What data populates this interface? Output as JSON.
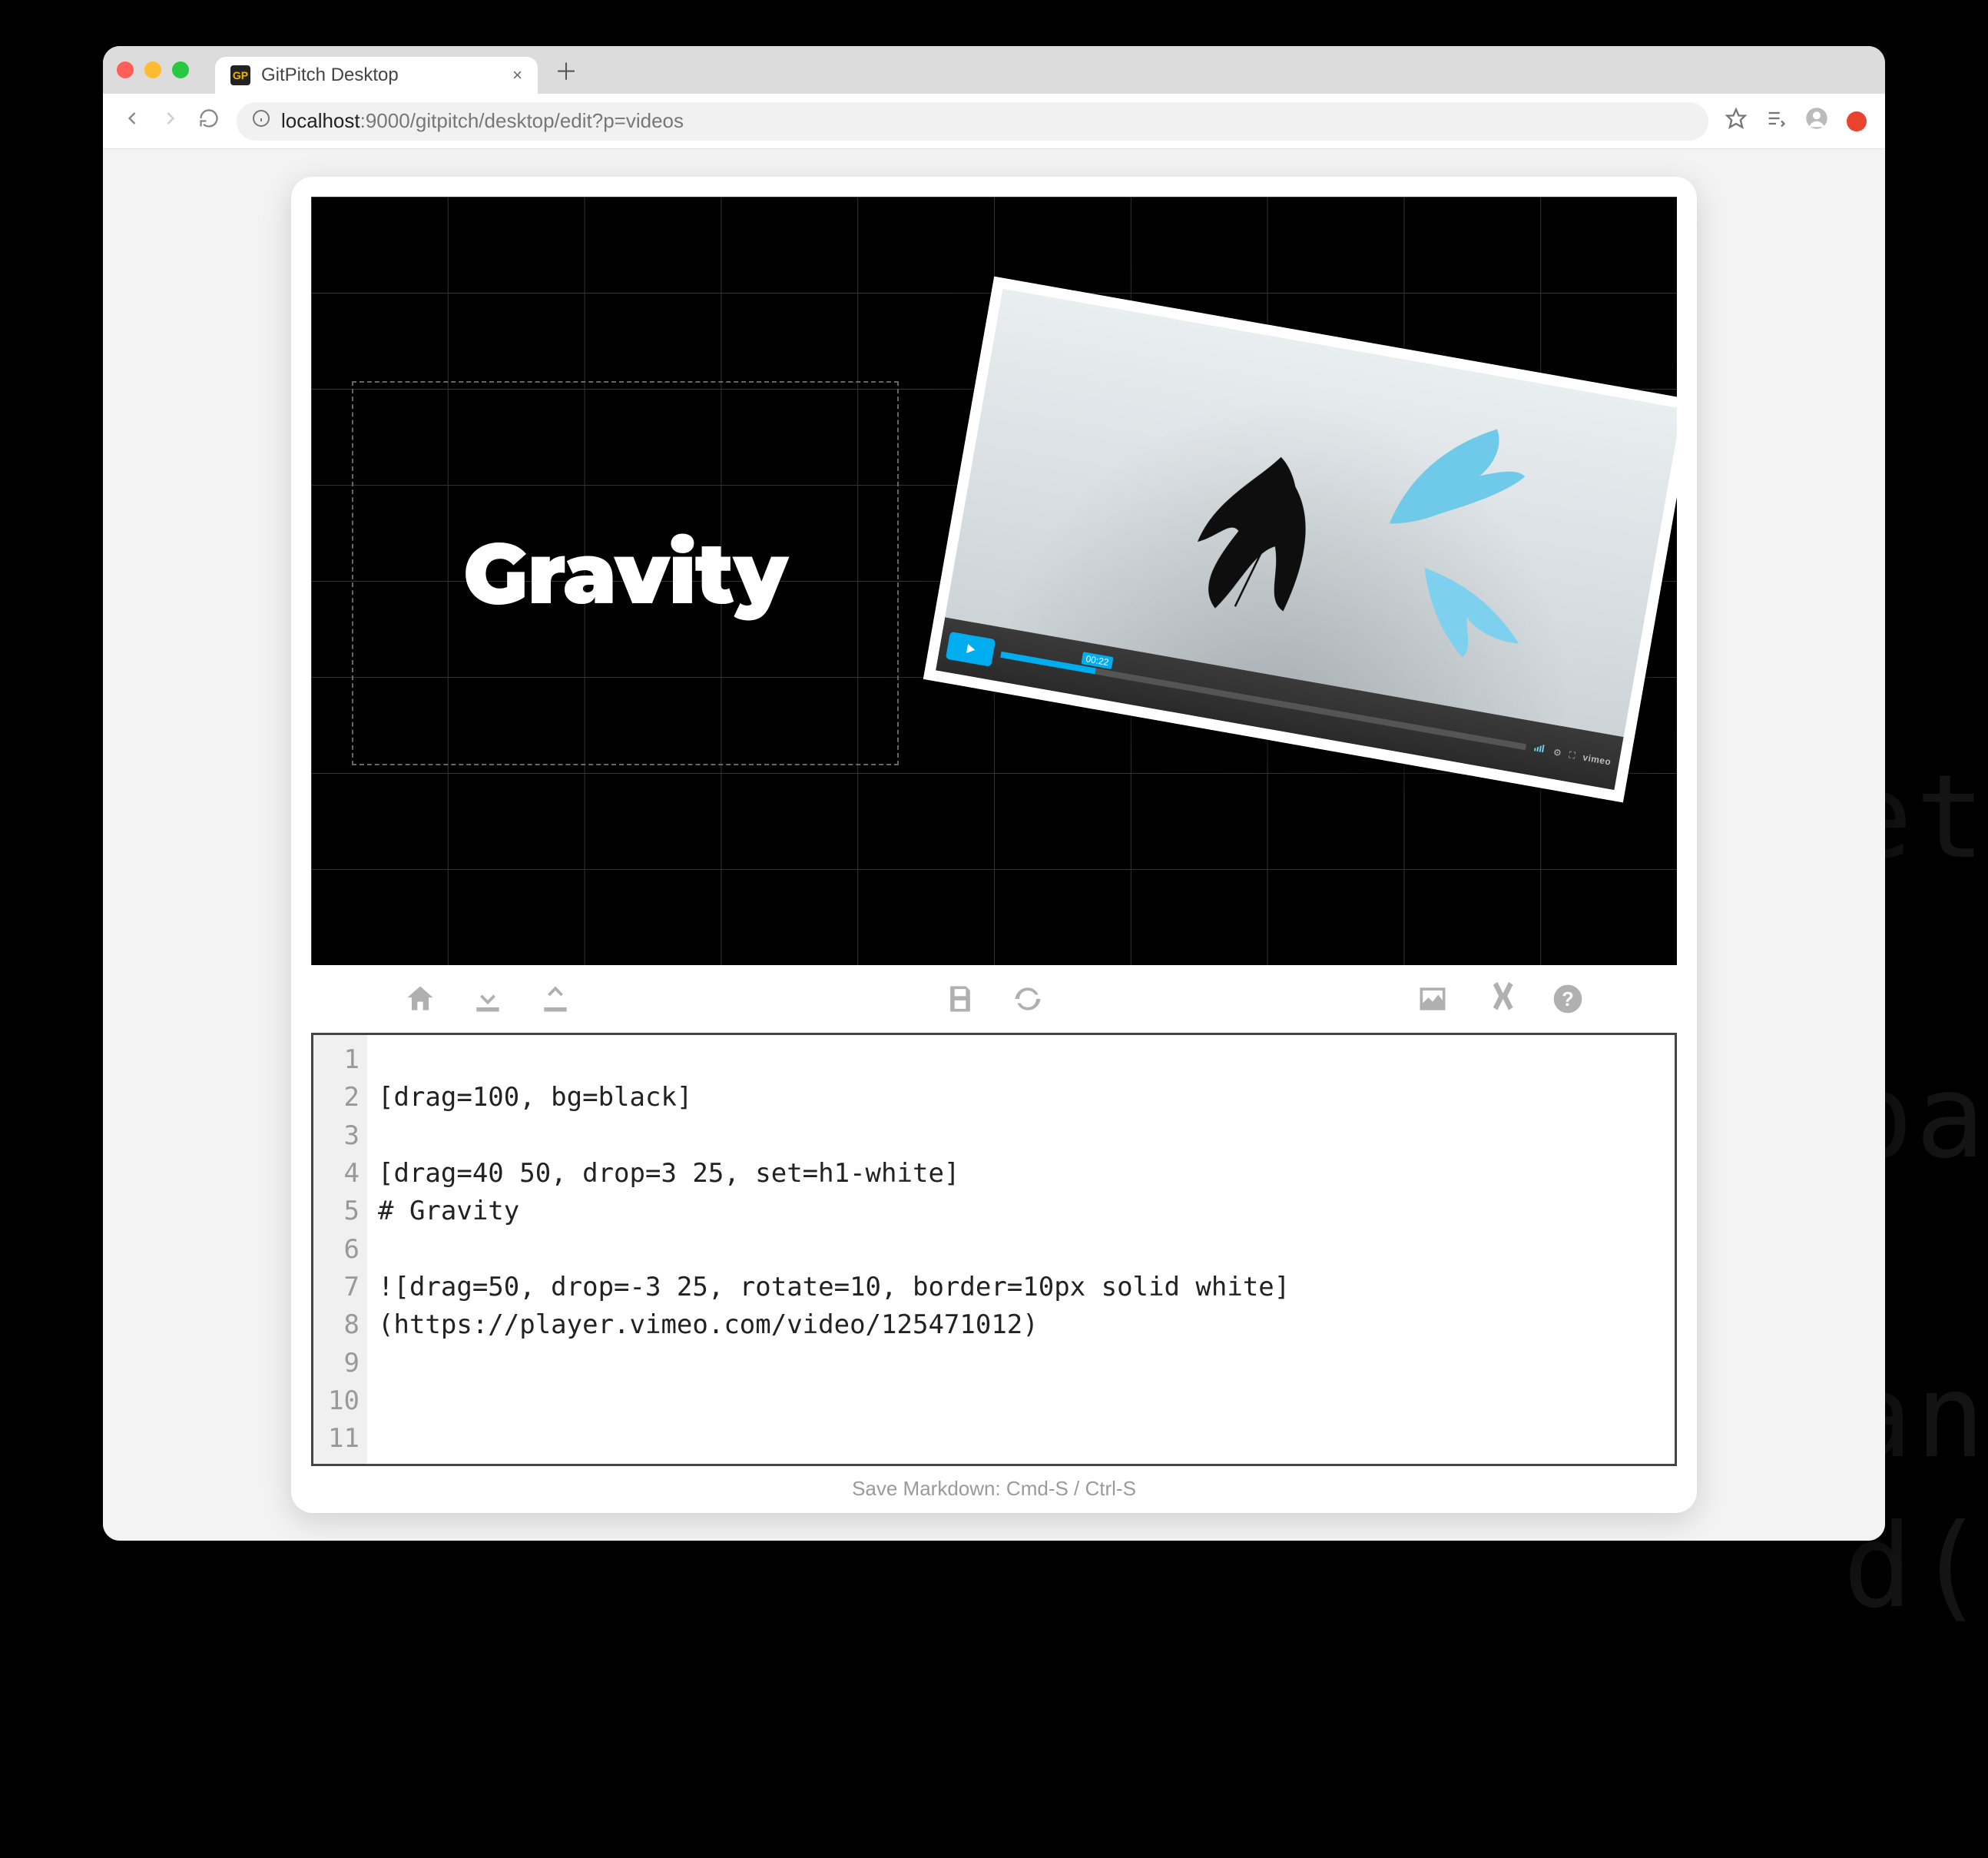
{
  "ghost_lines": "et\n\npa\n\nan\nd(",
  "browser": {
    "tab_title": "GitPitch Desktop",
    "favicon_text": "GP",
    "url_host": "localhost",
    "url_port": ":9000",
    "url_path": "/gitpitch/desktop/edit?p=videos"
  },
  "slide": {
    "title": "Gravity",
    "video_time": "00:22",
    "video_provider": "vimeo"
  },
  "toolbar": {
    "home": "Home",
    "download": "Download",
    "upload": "Upload",
    "save": "Save",
    "refresh": "Refresh",
    "image": "Image",
    "snippets": "Snippets",
    "help": "Help"
  },
  "editor": {
    "lines": [
      "",
      "[drag=100, bg=black]",
      "",
      "[drag=40 50, drop=3 25, set=h1-white]",
      "# Gravity",
      "",
      "![drag=50, drop=-3 25, rotate=10, border=10px solid white](https://player.vimeo.com/video/125471012)",
      "",
      "",
      "",
      ""
    ]
  },
  "status_hint": "Save Markdown: Cmd-S / Ctrl-S"
}
